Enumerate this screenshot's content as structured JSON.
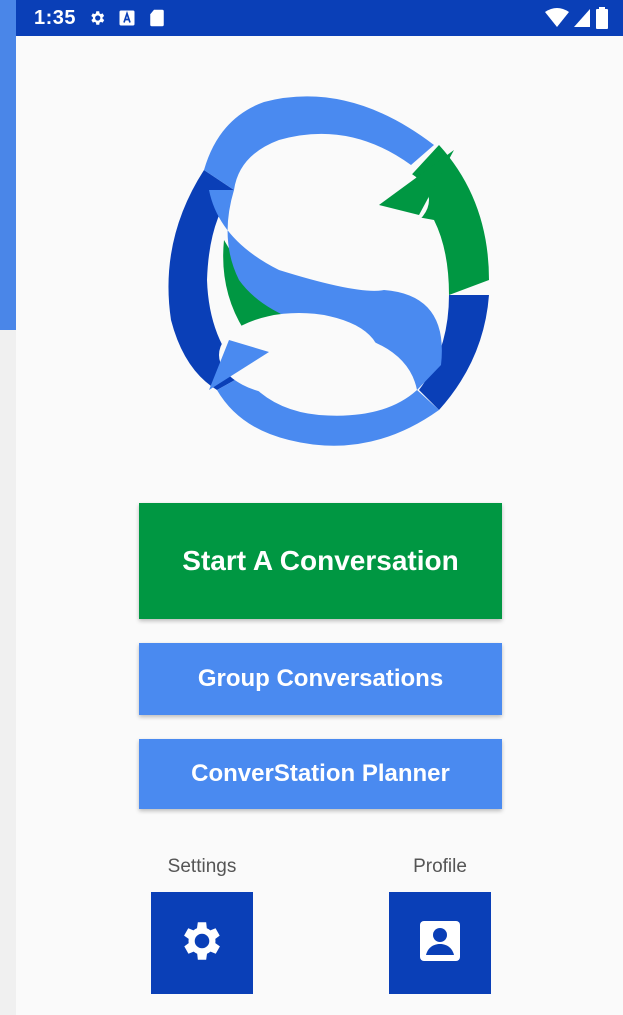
{
  "status_bar": {
    "time": "1:35",
    "icons": [
      "settings-icon",
      "a-box-icon",
      "sd-card-icon",
      "wifi-icon",
      "signal-icon",
      "battery-icon"
    ]
  },
  "colors": {
    "accent_green": "#009742",
    "accent_blue": "#4a8af0",
    "dark_blue": "#0a3fb7"
  },
  "main": {
    "logo_icon": "s-logo-icon",
    "start_button": "Start A Conversation",
    "group_button": "Group Conversations",
    "planner_button": "ConverStation Planner"
  },
  "bottom": {
    "settings_label": "Settings",
    "settings_icon": "gear-icon",
    "profile_label": "Profile",
    "profile_icon": "profile-icon"
  }
}
